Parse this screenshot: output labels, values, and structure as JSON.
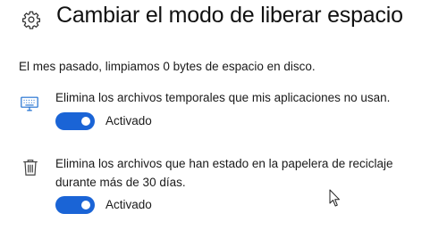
{
  "header": {
    "icon": "gear-icon",
    "title": "Cambiar el modo de liberar espacio"
  },
  "summary": "El mes pasado, limpiamos 0 bytes de espacio en disco.",
  "settings": [
    {
      "icon": "monitor-icon",
      "text": "Elimina los archivos temporales que mis aplicaciones no usan.",
      "toggle_state": "on",
      "toggle_label": "Activado"
    },
    {
      "icon": "trash-icon",
      "text": "Elimina los archivos que han estado en la papelera de reciclaje durante más de 30 días.",
      "toggle_state": "on",
      "toggle_label": "Activado"
    }
  ],
  "colors": {
    "accent": "#1a64d6",
    "icon_blue": "#1e6fd0",
    "text": "#1a1a1a"
  },
  "cursor": "mouse-pointer-icon"
}
